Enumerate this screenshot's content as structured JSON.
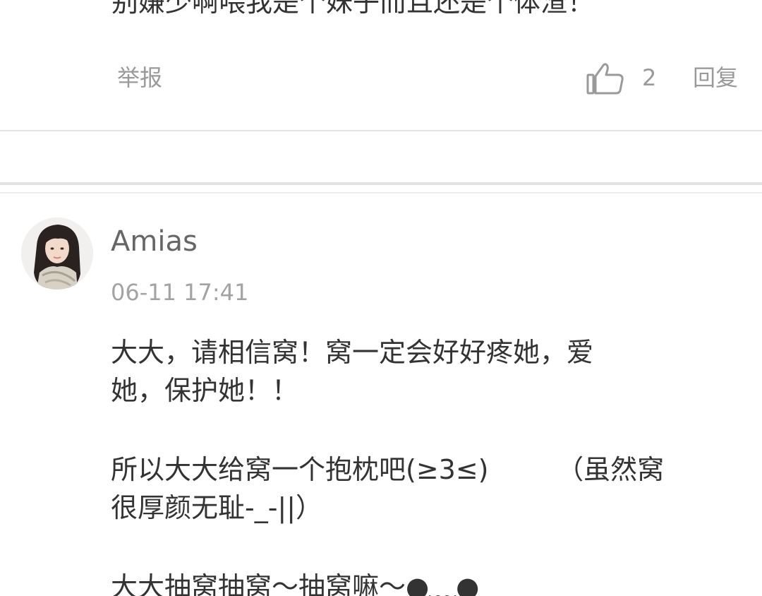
{
  "previous_comment": {
    "text_tail": "别嫌少啊喂我是个妹子而且还是个体渣！",
    "report_label": "举报",
    "like_count": "2",
    "reply_label": "回复",
    "like_icon": "thumbs-up-icon"
  },
  "comment": {
    "username": "Amias",
    "timestamp": "06-11 17:41",
    "avatar_icon": "user-avatar",
    "paragraphs": [
      "大大，请相信窝！窝一定会好好疼她，爱\n她，保护她！！",
      "所以大大给窝一个抱枕吧(≥3≤)        （虽然窝\n很厚颜无耻-_-||）",
      "大大抽窝抽窝～抽窝嘛～●﹏●"
    ]
  },
  "colors": {
    "text_primary": "#333333",
    "text_secondary": "#9a9a9a",
    "divider": "#e4e4e4"
  }
}
